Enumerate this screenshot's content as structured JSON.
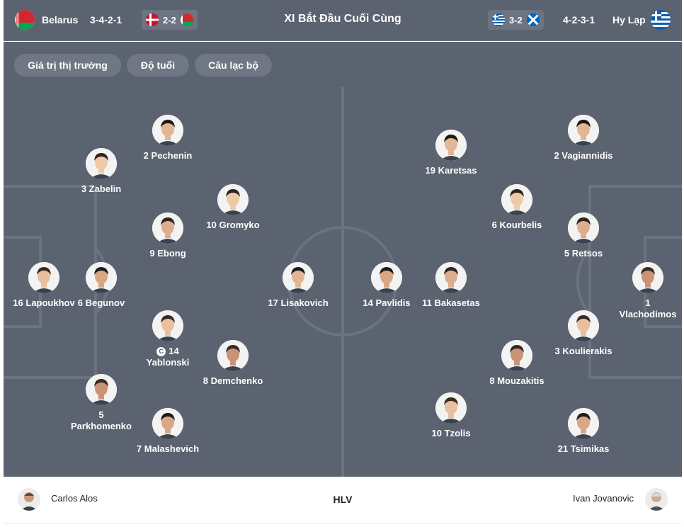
{
  "header": {
    "title": "XI Bắt Đầu Cuối Cùng",
    "home": {
      "name": "Belarus",
      "formation": "3-4-2-1",
      "flag_icon": "belarus-flag-icon"
    },
    "away": {
      "name": "Hy Lạp",
      "formation": "4-2-3-1",
      "flag_icon": "greece-flag-icon"
    },
    "home_last_result": {
      "score": "2-2",
      "icons": [
        "denmark-flag-icon",
        "belarus-flag-icon"
      ]
    },
    "away_last_result": {
      "score": "3-2",
      "icons": [
        "greece-flag-icon",
        "scotland-flag-icon"
      ]
    }
  },
  "filters": [
    "Giá trị thị trường",
    "Độ tuổi",
    "Câu lạc bộ"
  ],
  "home_players": [
    {
      "number": "16",
      "name": "Lapoukhov"
    },
    {
      "number": "6",
      "name": "Begunov"
    },
    {
      "number": "3",
      "name": "Zabelin"
    },
    {
      "number": "5",
      "name": "Parkhomenko"
    },
    {
      "number": "2",
      "name": "Pechenin"
    },
    {
      "number": "9",
      "name": "Ebong"
    },
    {
      "number": "14",
      "name": "Yablonski",
      "captain": true
    },
    {
      "number": "7",
      "name": "Malashevich"
    },
    {
      "number": "10",
      "name": "Gromyko"
    },
    {
      "number": "8",
      "name": "Demchenko"
    },
    {
      "number": "17",
      "name": "Lisakovich"
    }
  ],
  "away_players": [
    {
      "number": "1",
      "name": "Vlachodimos"
    },
    {
      "number": "2",
      "name": "Vagiannidis"
    },
    {
      "number": "5",
      "name": "Retsos"
    },
    {
      "number": "3",
      "name": "Koulierakis"
    },
    {
      "number": "21",
      "name": "Tsimikas"
    },
    {
      "number": "6",
      "name": "Kourbelis"
    },
    {
      "number": "8",
      "name": "Mouzakitis"
    },
    {
      "number": "19",
      "name": "Karetsas"
    },
    {
      "number": "11",
      "name": "Bakasetas"
    },
    {
      "number": "10",
      "name": "Tzolis"
    },
    {
      "number": "14",
      "name": "Pavlidis"
    }
  ],
  "captain_badge": "C",
  "coach": {
    "label": "HLV",
    "home": "Carlos Alos",
    "away": "Ivan Jovanovic"
  },
  "colors": {
    "pitch": "#5b6370",
    "chip": "#6f7785",
    "text": "#ffffff"
  }
}
